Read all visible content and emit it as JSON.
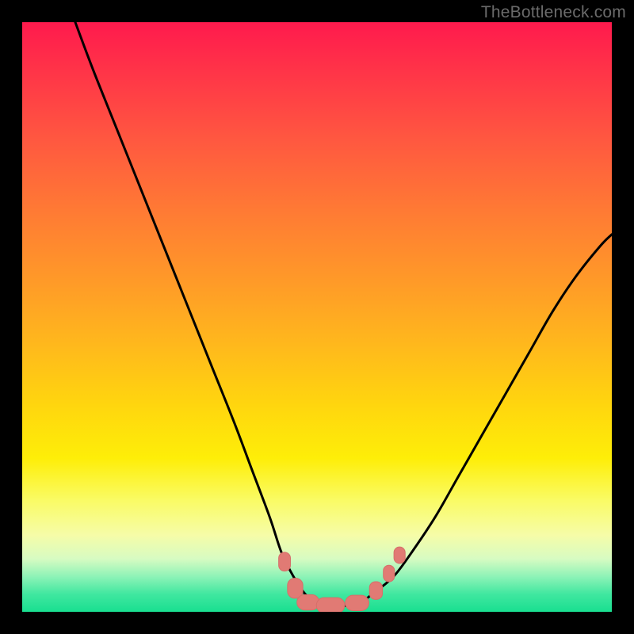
{
  "watermark": "TheBottleneck.com",
  "colors": {
    "frame": "#000000",
    "curve": "#000000",
    "marker_fill": "#e17a74",
    "marker_stroke": "#d66f6a"
  },
  "chart_data": {
    "type": "line",
    "title": "",
    "xlabel": "",
    "ylabel": "",
    "xlim": [
      0,
      100
    ],
    "ylim": [
      0,
      100
    ],
    "series": [
      {
        "name": "bottleneck-curve",
        "x": [
          9,
          12,
          16,
          20,
          24,
          28,
          32,
          36,
          39,
          42,
          44,
          46,
          48,
          50,
          52,
          54,
          56,
          58,
          60,
          63,
          66,
          70,
          74,
          78,
          82,
          86,
          90,
          94,
          98,
          100
        ],
        "y": [
          100,
          92,
          82,
          72,
          62,
          52,
          42,
          32,
          24,
          16,
          10,
          6,
          3,
          1.5,
          1,
          1,
          1.2,
          2,
          3.5,
          6,
          10,
          16,
          23,
          30,
          37,
          44,
          51,
          57,
          62,
          64
        ]
      }
    ],
    "markers": {
      "name": "optimal-range",
      "shape": "rounded-rect",
      "points": [
        {
          "x": 44.5,
          "y": 8.5,
          "w": 2.0,
          "h": 3.2,
          "r": 1.0
        },
        {
          "x": 46.3,
          "y": 4.0,
          "w": 2.6,
          "h": 3.4,
          "r": 1.2
        },
        {
          "x": 48.5,
          "y": 1.6,
          "w": 3.8,
          "h": 2.6,
          "r": 1.3
        },
        {
          "x": 52.3,
          "y": 1.1,
          "w": 4.8,
          "h": 2.6,
          "r": 1.3
        },
        {
          "x": 56.8,
          "y": 1.5,
          "w": 4.0,
          "h": 2.6,
          "r": 1.3
        },
        {
          "x": 60.0,
          "y": 3.6,
          "w": 2.2,
          "h": 3.0,
          "r": 1.0
        },
        {
          "x": 62.2,
          "y": 6.5,
          "w": 1.9,
          "h": 2.8,
          "r": 0.95
        },
        {
          "x": 64.0,
          "y": 9.6,
          "w": 1.9,
          "h": 2.8,
          "r": 0.95
        }
      ]
    }
  }
}
